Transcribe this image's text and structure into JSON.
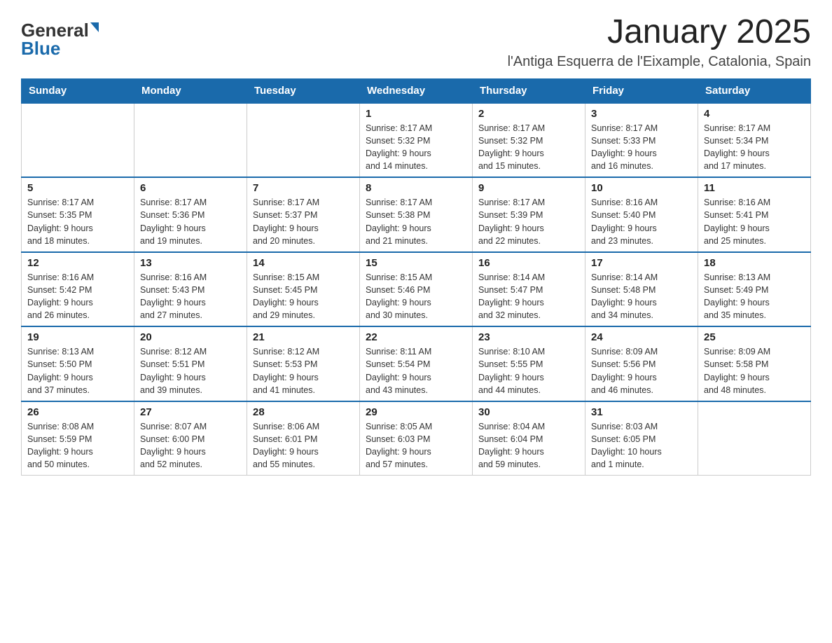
{
  "logo": {
    "general": "General",
    "blue": "Blue"
  },
  "title": "January 2025",
  "location": "l'Antiga Esquerra de l'Eixample, Catalonia, Spain",
  "days_of_week": [
    "Sunday",
    "Monday",
    "Tuesday",
    "Wednesday",
    "Thursday",
    "Friday",
    "Saturday"
  ],
  "weeks": [
    [
      {
        "day": "",
        "info": ""
      },
      {
        "day": "",
        "info": ""
      },
      {
        "day": "",
        "info": ""
      },
      {
        "day": "1",
        "info": "Sunrise: 8:17 AM\nSunset: 5:32 PM\nDaylight: 9 hours\nand 14 minutes."
      },
      {
        "day": "2",
        "info": "Sunrise: 8:17 AM\nSunset: 5:32 PM\nDaylight: 9 hours\nand 15 minutes."
      },
      {
        "day": "3",
        "info": "Sunrise: 8:17 AM\nSunset: 5:33 PM\nDaylight: 9 hours\nand 16 minutes."
      },
      {
        "day": "4",
        "info": "Sunrise: 8:17 AM\nSunset: 5:34 PM\nDaylight: 9 hours\nand 17 minutes."
      }
    ],
    [
      {
        "day": "5",
        "info": "Sunrise: 8:17 AM\nSunset: 5:35 PM\nDaylight: 9 hours\nand 18 minutes."
      },
      {
        "day": "6",
        "info": "Sunrise: 8:17 AM\nSunset: 5:36 PM\nDaylight: 9 hours\nand 19 minutes."
      },
      {
        "day": "7",
        "info": "Sunrise: 8:17 AM\nSunset: 5:37 PM\nDaylight: 9 hours\nand 20 minutes."
      },
      {
        "day": "8",
        "info": "Sunrise: 8:17 AM\nSunset: 5:38 PM\nDaylight: 9 hours\nand 21 minutes."
      },
      {
        "day": "9",
        "info": "Sunrise: 8:17 AM\nSunset: 5:39 PM\nDaylight: 9 hours\nand 22 minutes."
      },
      {
        "day": "10",
        "info": "Sunrise: 8:16 AM\nSunset: 5:40 PM\nDaylight: 9 hours\nand 23 minutes."
      },
      {
        "day": "11",
        "info": "Sunrise: 8:16 AM\nSunset: 5:41 PM\nDaylight: 9 hours\nand 25 minutes."
      }
    ],
    [
      {
        "day": "12",
        "info": "Sunrise: 8:16 AM\nSunset: 5:42 PM\nDaylight: 9 hours\nand 26 minutes."
      },
      {
        "day": "13",
        "info": "Sunrise: 8:16 AM\nSunset: 5:43 PM\nDaylight: 9 hours\nand 27 minutes."
      },
      {
        "day": "14",
        "info": "Sunrise: 8:15 AM\nSunset: 5:45 PM\nDaylight: 9 hours\nand 29 minutes."
      },
      {
        "day": "15",
        "info": "Sunrise: 8:15 AM\nSunset: 5:46 PM\nDaylight: 9 hours\nand 30 minutes."
      },
      {
        "day": "16",
        "info": "Sunrise: 8:14 AM\nSunset: 5:47 PM\nDaylight: 9 hours\nand 32 minutes."
      },
      {
        "day": "17",
        "info": "Sunrise: 8:14 AM\nSunset: 5:48 PM\nDaylight: 9 hours\nand 34 minutes."
      },
      {
        "day": "18",
        "info": "Sunrise: 8:13 AM\nSunset: 5:49 PM\nDaylight: 9 hours\nand 35 minutes."
      }
    ],
    [
      {
        "day": "19",
        "info": "Sunrise: 8:13 AM\nSunset: 5:50 PM\nDaylight: 9 hours\nand 37 minutes."
      },
      {
        "day": "20",
        "info": "Sunrise: 8:12 AM\nSunset: 5:51 PM\nDaylight: 9 hours\nand 39 minutes."
      },
      {
        "day": "21",
        "info": "Sunrise: 8:12 AM\nSunset: 5:53 PM\nDaylight: 9 hours\nand 41 minutes."
      },
      {
        "day": "22",
        "info": "Sunrise: 8:11 AM\nSunset: 5:54 PM\nDaylight: 9 hours\nand 43 minutes."
      },
      {
        "day": "23",
        "info": "Sunrise: 8:10 AM\nSunset: 5:55 PM\nDaylight: 9 hours\nand 44 minutes."
      },
      {
        "day": "24",
        "info": "Sunrise: 8:09 AM\nSunset: 5:56 PM\nDaylight: 9 hours\nand 46 minutes."
      },
      {
        "day": "25",
        "info": "Sunrise: 8:09 AM\nSunset: 5:58 PM\nDaylight: 9 hours\nand 48 minutes."
      }
    ],
    [
      {
        "day": "26",
        "info": "Sunrise: 8:08 AM\nSunset: 5:59 PM\nDaylight: 9 hours\nand 50 minutes."
      },
      {
        "day": "27",
        "info": "Sunrise: 8:07 AM\nSunset: 6:00 PM\nDaylight: 9 hours\nand 52 minutes."
      },
      {
        "day": "28",
        "info": "Sunrise: 8:06 AM\nSunset: 6:01 PM\nDaylight: 9 hours\nand 55 minutes."
      },
      {
        "day": "29",
        "info": "Sunrise: 8:05 AM\nSunset: 6:03 PM\nDaylight: 9 hours\nand 57 minutes."
      },
      {
        "day": "30",
        "info": "Sunrise: 8:04 AM\nSunset: 6:04 PM\nDaylight: 9 hours\nand 59 minutes."
      },
      {
        "day": "31",
        "info": "Sunrise: 8:03 AM\nSunset: 6:05 PM\nDaylight: 10 hours\nand 1 minute."
      },
      {
        "day": "",
        "info": ""
      }
    ]
  ]
}
